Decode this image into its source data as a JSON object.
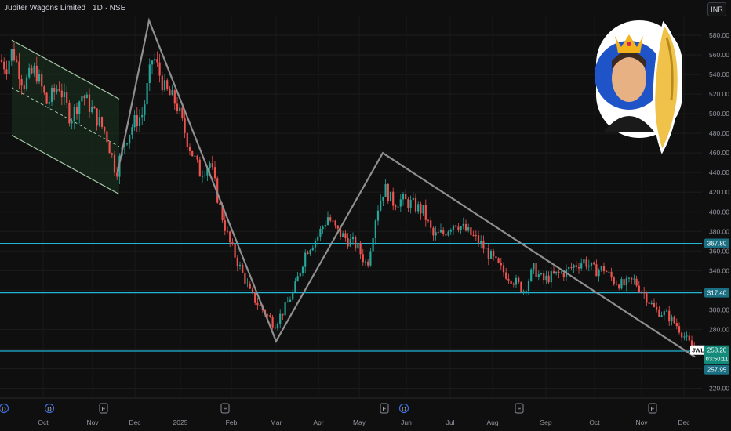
{
  "header": {
    "title": "Jupiter Wagons Limited · 1D · NSE",
    "currency": "INR"
  },
  "colors": {
    "background": "#0f0f0f",
    "up": "#26a69a",
    "down": "#ef5350",
    "level": "#22b5d6",
    "pattern": "#8f8f8f",
    "channel_fill": "#1b3320"
  },
  "chart_data": {
    "type": "candlestick",
    "title": "Jupiter Wagons Limited · 1D · NSE",
    "ylim": [
      210,
      600
    ],
    "y_ticks": [
      220,
      240,
      260,
      280,
      300,
      320,
      340,
      360,
      380,
      400,
      420,
      440,
      460,
      480,
      500,
      520,
      540,
      560,
      580
    ],
    "x_tick_labels": [
      "Oct",
      "Nov",
      "Dec",
      "2025",
      "Feb",
      "Mar",
      "Apr",
      "May",
      "Jun",
      "Jul",
      "Aug",
      "Sep",
      "Oct",
      "Nov",
      "Dec"
    ],
    "x_events": [
      "D",
      "D",
      "E",
      "E",
      "E",
      "D",
      "E",
      "E"
    ],
    "grid": true,
    "horizontal_levels": [
      {
        "label": "367.80",
        "value": 367.8
      },
      {
        "label": "317.40",
        "value": 317.4
      },
      {
        "label": "257.95",
        "value": 257.95
      }
    ],
    "last_price": {
      "symbol": "JWL",
      "price": "258.20",
      "countdown": "03:50:11"
    },
    "zigzag_points": [
      {
        "x": "Nov",
        "y": 440
      },
      {
        "x": "Dec",
        "y": 595
      },
      {
        "x": "Mar",
        "y": 268
      },
      {
        "x": "May",
        "y": 460
      },
      {
        "x": "Dec",
        "y": 252
      }
    ],
    "channel": {
      "upper": [
        575,
        515
      ],
      "lower": [
        478,
        418
      ]
    },
    "series_trend": [
      [
        0,
        555
      ],
      [
        8,
        548
      ],
      [
        16,
        565
      ],
      [
        30,
        530
      ],
      [
        45,
        545
      ],
      [
        60,
        510
      ],
      [
        75,
        530
      ],
      [
        90,
        495
      ],
      [
        105,
        520
      ],
      [
        120,
        500
      ],
      [
        135,
        480
      ],
      [
        148,
        440
      ],
      [
        158,
        470
      ],
      [
        170,
        490
      ],
      [
        182,
        500
      ],
      [
        195,
        560
      ],
      [
        210,
        525
      ],
      [
        225,
        510
      ],
      [
        240,
        470
      ],
      [
        255,
        440
      ],
      [
        268,
        450
      ],
      [
        280,
        405
      ],
      [
        292,
        370
      ],
      [
        305,
        345
      ],
      [
        320,
        315
      ],
      [
        335,
        300
      ],
      [
        350,
        285
      ],
      [
        362,
        300
      ],
      [
        375,
        320
      ],
      [
        390,
        360
      ],
      [
        405,
        375
      ],
      [
        418,
        395
      ],
      [
        430,
        380
      ],
      [
        442,
        372
      ],
      [
        455,
        365
      ],
      [
        468,
        345
      ],
      [
        480,
        400
      ],
      [
        490,
        425
      ],
      [
        500,
        410
      ],
      [
        512,
        412
      ],
      [
        525,
        408
      ],
      [
        540,
        400
      ],
      [
        552,
        375
      ],
      [
        565,
        378
      ],
      [
        580,
        390
      ],
      [
        595,
        380
      ],
      [
        610,
        370
      ],
      [
        625,
        355
      ],
      [
        640,
        340
      ],
      [
        655,
        330
      ],
      [
        668,
        320
      ],
      [
        680,
        342
      ],
      [
        692,
        330
      ],
      [
        705,
        335
      ],
      [
        720,
        338
      ],
      [
        732,
        345
      ],
      [
        745,
        350
      ],
      [
        758,
        340
      ],
      [
        770,
        342
      ],
      [
        782,
        330
      ],
      [
        795,
        325
      ],
      [
        808,
        330
      ],
      [
        820,
        318
      ],
      [
        835,
        300
      ],
      [
        850,
        295
      ],
      [
        862,
        285
      ],
      [
        875,
        270
      ],
      [
        886,
        258
      ]
    ]
  }
}
